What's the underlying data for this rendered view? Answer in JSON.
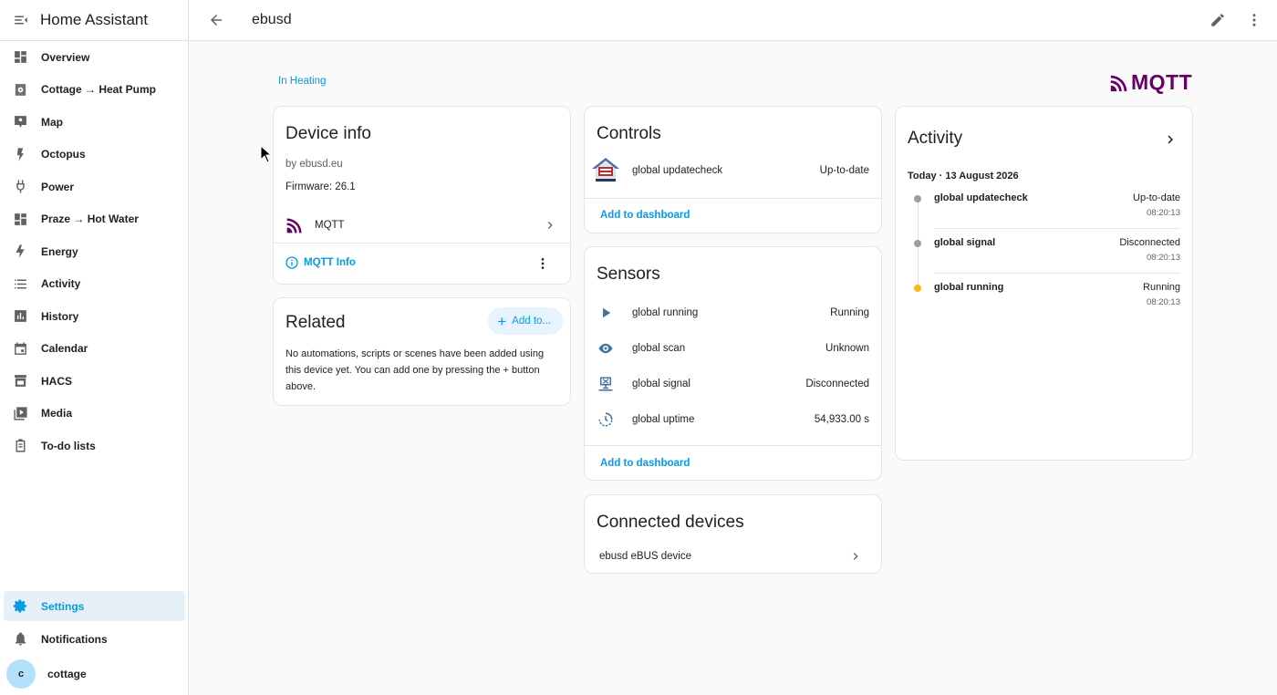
{
  "app": {
    "title": "Home Assistant"
  },
  "sidebar": {
    "items": [
      {
        "label": "Overview",
        "icon": "dashboard-icon"
      },
      {
        "label": "Cottage → Heat Pump",
        "icon": "heat-pump-icon"
      },
      {
        "label": "Map",
        "icon": "map-icon"
      },
      {
        "label": "Octopus",
        "icon": "lightning-icon"
      },
      {
        "label": "Power",
        "icon": "plug-icon"
      },
      {
        "label": "Praze → Hot Water",
        "icon": "dashboard-icon"
      },
      {
        "label": "Energy",
        "icon": "lightning-icon"
      },
      {
        "label": "Activity",
        "icon": "list-icon"
      },
      {
        "label": "History",
        "icon": "chart-icon"
      },
      {
        "label": "Calendar",
        "icon": "calendar-icon"
      },
      {
        "label": "HACS",
        "icon": "store-icon"
      },
      {
        "label": "Media",
        "icon": "media-icon"
      },
      {
        "label": "To-do lists",
        "icon": "clipboard-icon"
      }
    ],
    "settings": "Settings",
    "notifications": "Notifications",
    "user": {
      "initial": "c",
      "name": "cottage"
    }
  },
  "topbar": {
    "title": "ebusd"
  },
  "area": "In Heating",
  "brand": {
    "text": "MQTT",
    "color": "#660066"
  },
  "device_info": {
    "title": "Device info",
    "manufacturer": "by ebusd.eu",
    "firmware": "Firmware: 26.1",
    "integration": "MQTT",
    "info_link": "MQTT Info"
  },
  "related": {
    "title": "Related",
    "add_button": "Add to...",
    "text": "No automations, scripts or scenes have been added using this device yet. You can add one by pressing the + button above."
  },
  "controls": {
    "title": "Controls",
    "rows": [
      {
        "name": "global updatecheck",
        "value": "Up-to-date"
      }
    ],
    "add": "Add to dashboard"
  },
  "sensors": {
    "title": "Sensors",
    "rows": [
      {
        "name": "global running",
        "value": "Running",
        "icon": "play-icon"
      },
      {
        "name": "global scan",
        "value": "Unknown",
        "icon": "eye-icon"
      },
      {
        "name": "global signal",
        "value": "Disconnected",
        "icon": "network-off-icon"
      },
      {
        "name": "global uptime",
        "value": "54,933.00 s",
        "icon": "timer-icon"
      }
    ],
    "add": "Add to dashboard"
  },
  "connected": {
    "title": "Connected devices",
    "rows": [
      {
        "name": "ebusd eBUS device"
      }
    ]
  },
  "activity": {
    "title": "Activity",
    "date": "Today · 13 August 2026",
    "entries": [
      {
        "name": "global updatecheck",
        "value": "Up-to-date",
        "time": "08:20:13",
        "dot": "#9e9e9e"
      },
      {
        "name": "global signal",
        "value": "Disconnected",
        "time": "08:20:13",
        "dot": "#9e9e9e"
      },
      {
        "name": "global running",
        "value": "Running",
        "time": "08:20:13",
        "dot": "#fdb91c"
      }
    ]
  },
  "colors": {
    "accent": "#039be5",
    "mqtt": "#660066"
  }
}
